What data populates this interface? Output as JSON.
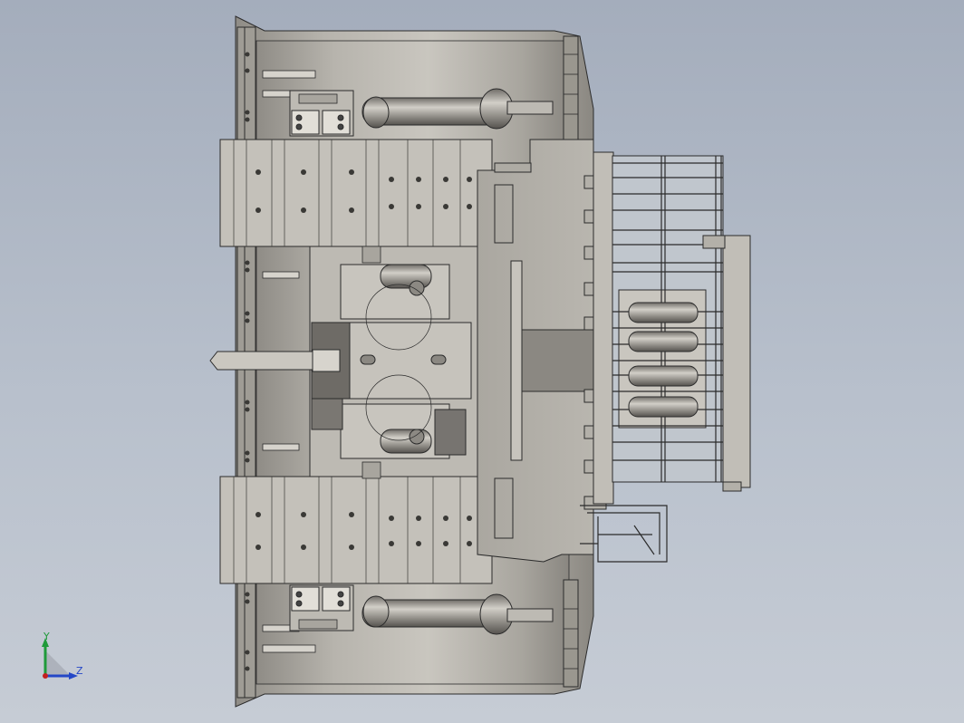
{
  "view": {
    "title": "",
    "background_top": "#a4adbc",
    "background_bottom": "#c6ccd5"
  },
  "model": {
    "description_visible": false,
    "colors": {
      "steel": "#a9a69f",
      "steel_light": "#bdbab3",
      "steel_dark": "#6f6c67",
      "outline": "#2b2b2b",
      "shadow": "#4a4845"
    }
  },
  "triad": {
    "y_label": "Y",
    "z_label": "Z",
    "y_color": "#1f9a3a",
    "z_color": "#2447c7",
    "x_color": "#c41f1f"
  }
}
